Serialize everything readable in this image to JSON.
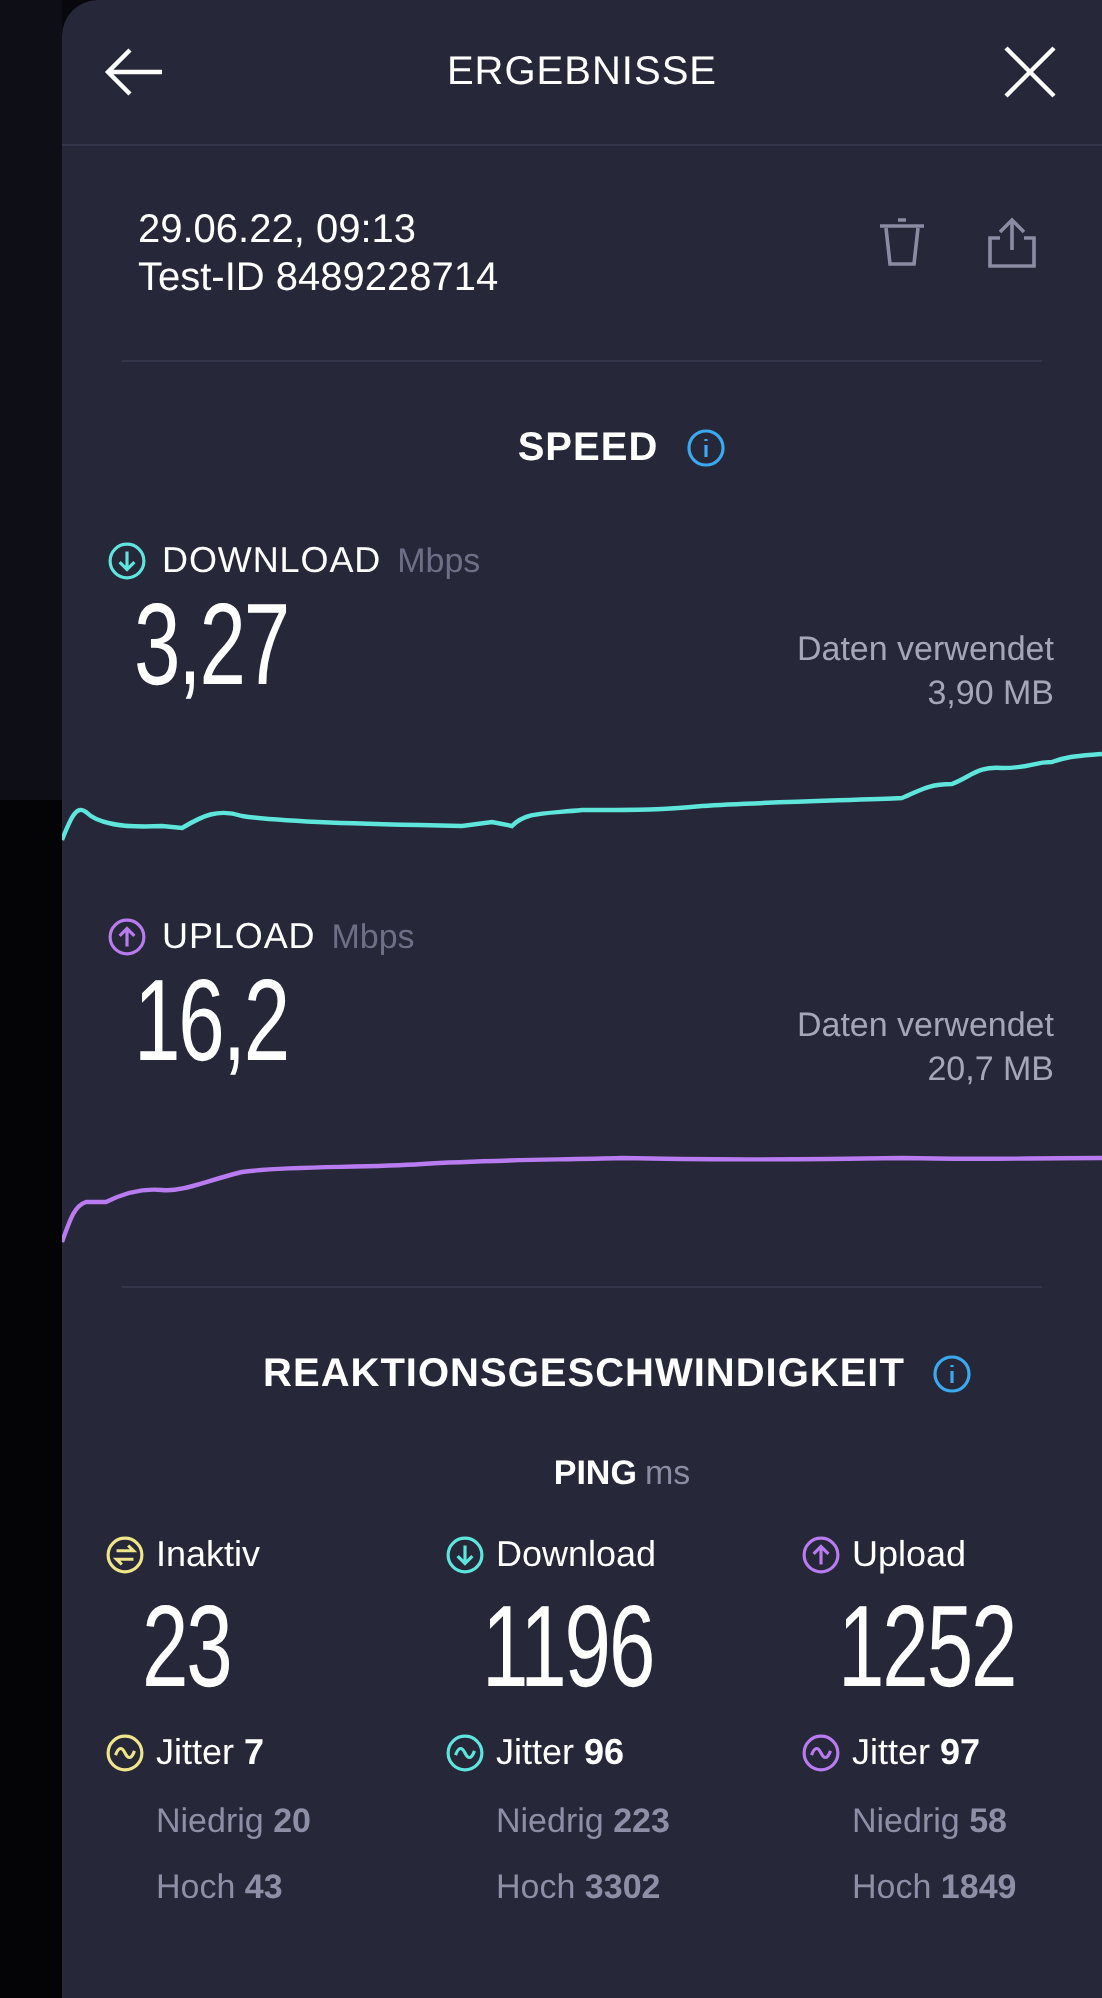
{
  "header": {
    "title": "ERGEBNISSE"
  },
  "test": {
    "date": "29.06.22, 09:13",
    "test_id": "Test-ID 8489228714"
  },
  "speed": {
    "title": "SPEED",
    "results": [
      {
        "kind": "download",
        "label": "DOWNLOAD",
        "unit": "Mbps",
        "value": "3,27",
        "data_label": "Daten verwendet",
        "data_value": "3,90 MB"
      },
      {
        "kind": "upload",
        "label": "UPLOAD",
        "unit": "Mbps",
        "value": "16,2",
        "data_label": "Daten verwendet",
        "data_value": "20,7 MB"
      }
    ]
  },
  "responsiveness": {
    "title": "REAKTIONSGESCHWINDIGKEIT",
    "ping_label": "PING",
    "ping_unit": "ms",
    "columns": [
      {
        "kind": "idle",
        "label": "Inaktiv",
        "value": "23",
        "jitter_label": "Jitter",
        "jitter": "7",
        "low_label": "Niedrig",
        "low": "20",
        "high_label": "Hoch",
        "high": "43"
      },
      {
        "kind": "download",
        "label": "Download",
        "value": "1196",
        "jitter_label": "Jitter",
        "jitter": "96",
        "low_label": "Niedrig",
        "low": "223",
        "high_label": "Hoch",
        "high": "3302"
      },
      {
        "kind": "upload",
        "label": "Upload",
        "value": "1252",
        "jitter_label": "Jitter",
        "jitter": "97",
        "low_label": "Niedrig",
        "low": "58",
        "high_label": "Hoch",
        "high": "1849"
      }
    ]
  }
}
